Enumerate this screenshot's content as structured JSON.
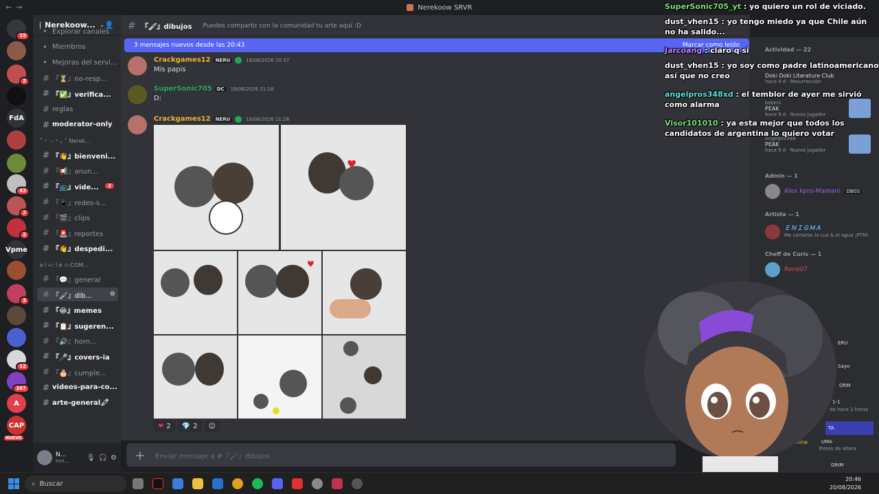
{
  "window": {
    "title": "Nerekoow SRVR"
  },
  "rail": {
    "servers": [
      {
        "label": "",
        "badge": "15",
        "color": "#35373c"
      },
      {
        "label": "",
        "badge": "",
        "color": "#8a5a4a"
      },
      {
        "label": "",
        "badge": "2",
        "color": "#c05050"
      },
      {
        "label": "",
        "badge": "",
        "color": "#111111"
      },
      {
        "label": "FdA",
        "badge": "",
        "color": "#313338"
      },
      {
        "label": "",
        "badge": "",
        "color": "#b04040"
      },
      {
        "label": "",
        "badge": "",
        "color": "#6d8a3a"
      },
      {
        "label": "",
        "badge": "43",
        "color": "#c0c0c0"
      },
      {
        "label": "",
        "badge": "2",
        "color": "#bb5555"
      },
      {
        "label": "",
        "badge": "2",
        "color": "#c03040"
      },
      {
        "label": "Vpme",
        "badge": "",
        "color": "#313338"
      },
      {
        "label": "",
        "badge": "",
        "color": "#9a5030"
      },
      {
        "label": "",
        "badge": "3",
        "color": "#c04060"
      },
      {
        "label": "",
        "badge": "",
        "color": "#5a4a3a"
      },
      {
        "label": "",
        "badge": "",
        "color": "#4a60d0"
      },
      {
        "label": "",
        "badge": "12",
        "color": "#d8d8d8"
      },
      {
        "label": "",
        "badge": "267",
        "color": "#8040c0"
      },
      {
        "label": "A",
        "badge": "",
        "color": "#e04050"
      },
      {
        "label": "CAP",
        "badge": "",
        "color": "#d03030",
        "tag": "NUEVO"
      }
    ]
  },
  "sidebar": {
    "server_name": "Nerekoow...",
    "items": [
      {
        "kind": "plain",
        "label": "Explorar canales"
      },
      {
        "kind": "plain",
        "label": "Miembros"
      },
      {
        "kind": "plain",
        "label": "Mejoras del servi..."
      },
      {
        "kind": "ch",
        "label": "『⏳』no-resp..."
      },
      {
        "kind": "ch",
        "label": "『✅』verifica...",
        "bright": true
      },
      {
        "kind": "ch",
        "label": "reglas"
      },
      {
        "kind": "ch",
        "label": "moderator-only",
        "bright": true
      },
      {
        "kind": "cat",
        "label": "˚ ⁺ ‧₊ ⁺ ｡ ˚ Nerek..."
      },
      {
        "kind": "ch",
        "label": "『👋』bienveni...",
        "bright": true
      },
      {
        "kind": "ch",
        "label": "『📢』anun..."
      },
      {
        "kind": "ch",
        "label": "『📺』vide...",
        "bright": true,
        "badge": "2"
      },
      {
        "kind": "ch",
        "label": "『📱』redes-s..."
      },
      {
        "kind": "ch",
        "label": "『🎬』clips"
      },
      {
        "kind": "ch",
        "label": "『🚨』reportes"
      },
      {
        "kind": "ch",
        "label": "『👋』despedi...",
        "bright": true
      },
      {
        "kind": "cat",
        "label": "ʚ꒰⊹:꒱ɞ ⊹:COM..."
      },
      {
        "kind": "ch",
        "label": "『💬』general"
      },
      {
        "kind": "ch",
        "label": "『🖌』dib...",
        "active": true
      },
      {
        "kind": "ch",
        "label": "『😂』memes",
        "bright": true
      },
      {
        "kind": "ch",
        "label": "『📋』sugeren...",
        "bright": true
      },
      {
        "kind": "ch",
        "label": "『🔊』horn..."
      },
      {
        "kind": "ch",
        "label": "『🎤』covers-ia",
        "bright": true
      },
      {
        "kind": "ch",
        "label": "『🎂』cumple..."
      },
      {
        "kind": "ch",
        "label": "videos-para-co...",
        "bright": true
      },
      {
        "kind": "ch",
        "label": "arte-general🖍",
        "bright": true
      }
    ],
    "user": {
      "name": "N...",
      "status": "Invi..."
    }
  },
  "channel": {
    "name": "『🖌』dibujos",
    "topic": "Puedes compartir con la comunidad tu arte aqui :D",
    "new_messages_bar": "3 mensajes nuevos desde las 20:43",
    "mark_read": "Marcar como leído"
  },
  "messages": [
    {
      "author": "Crackgames12",
      "tag": "NERU",
      "time": "18/08/2026 20:37",
      "text": "Mis papis",
      "color": "#f0b232"
    },
    {
      "author": "SuperSonic705",
      "tag": "DC",
      "time": "18/08/2026 21:18",
      "text": "D:",
      "color": "#23a559"
    },
    {
      "author": "Crackgames12",
      "tag": "NERU",
      "time": "18/08/2026 21:28",
      "text": "",
      "color": "#f0b232"
    }
  ],
  "reactions": [
    {
      "emoji": "❤",
      "count": "2"
    },
    {
      "emoji": "💎",
      "count": "2"
    }
  ],
  "input": {
    "placeholder": "Enviar mensaje a #『🖌』dibujos"
  },
  "members": {
    "activity_header": "Actividad — 22",
    "activity": [
      {
        "title": "Doki Doki Literature Club",
        "sub": "hace 4 d · Resurrección"
      },
      {
        "user": "kobeni",
        "title": "PEAK",
        "sub": "hace 9 d · Nuevo jugador"
      },
      {
        "user": "Angelpro348",
        "title": "PEAK",
        "sub": "hace 9 d · Nuevo jugador"
      }
    ],
    "groups": [
      {
        "header": "Admin — 1",
        "name": "Alex kpro-Mamani",
        "tag": "DBGS",
        "status": "",
        "color": "#a45ce0"
      },
      {
        "header": "Artista — 1",
        "name": "ＥＮＩＧＭＡ",
        "tag": "",
        "status": "Me cortaron la Luz & el agua ¡PTM!",
        "color": "#5fa8e6"
      },
      {
        "header": "Cheff de Curis — 1",
        "name": "René07",
        "tag": "",
        "status": "",
        "color": "#e05050"
      }
    ],
    "partial": [
      "ERU",
      "Sayo",
      "ORM",
      "1-1",
      "de hace 2 horas",
      "TA",
      "Uphine",
      "UMA",
      "thines de ahora",
      "GRIM"
    ]
  },
  "overlay_chat": [
    {
      "user": "SuperSonic705_yt",
      "text": "yo quiero un rol de viciado.",
      "color": "#7ee07e"
    },
    {
      "user": "dust_vhen15",
      "text": "yo tengo miedo ya que Chile aún no ha salido...",
      "color": "#ffffff"
    },
    {
      "user": "Jarcoang",
      "text": "claro q si",
      "color": "#c080ff"
    },
    {
      "user": "dust_vhen15",
      "text": "yo soy como padre latinoamericano así que no creo",
      "color": "#ffffff"
    },
    {
      "user": "angelpros348xd",
      "text": "el temblor de ayer me sirvió como alarma",
      "color": "#60e0e0"
    },
    {
      "user": "Visor101010",
      "text": "ya esta mejor que todos los candidatos de argentina lo quiero votar",
      "color": "#7ee07e"
    }
  ],
  "taskbar": {
    "search": "Buscar",
    "time": "20:46",
    "date": "20/08/2026"
  },
  "colors": {
    "accent": "#5865f2",
    "danger": "#f23f43",
    "online": "#23a559"
  }
}
